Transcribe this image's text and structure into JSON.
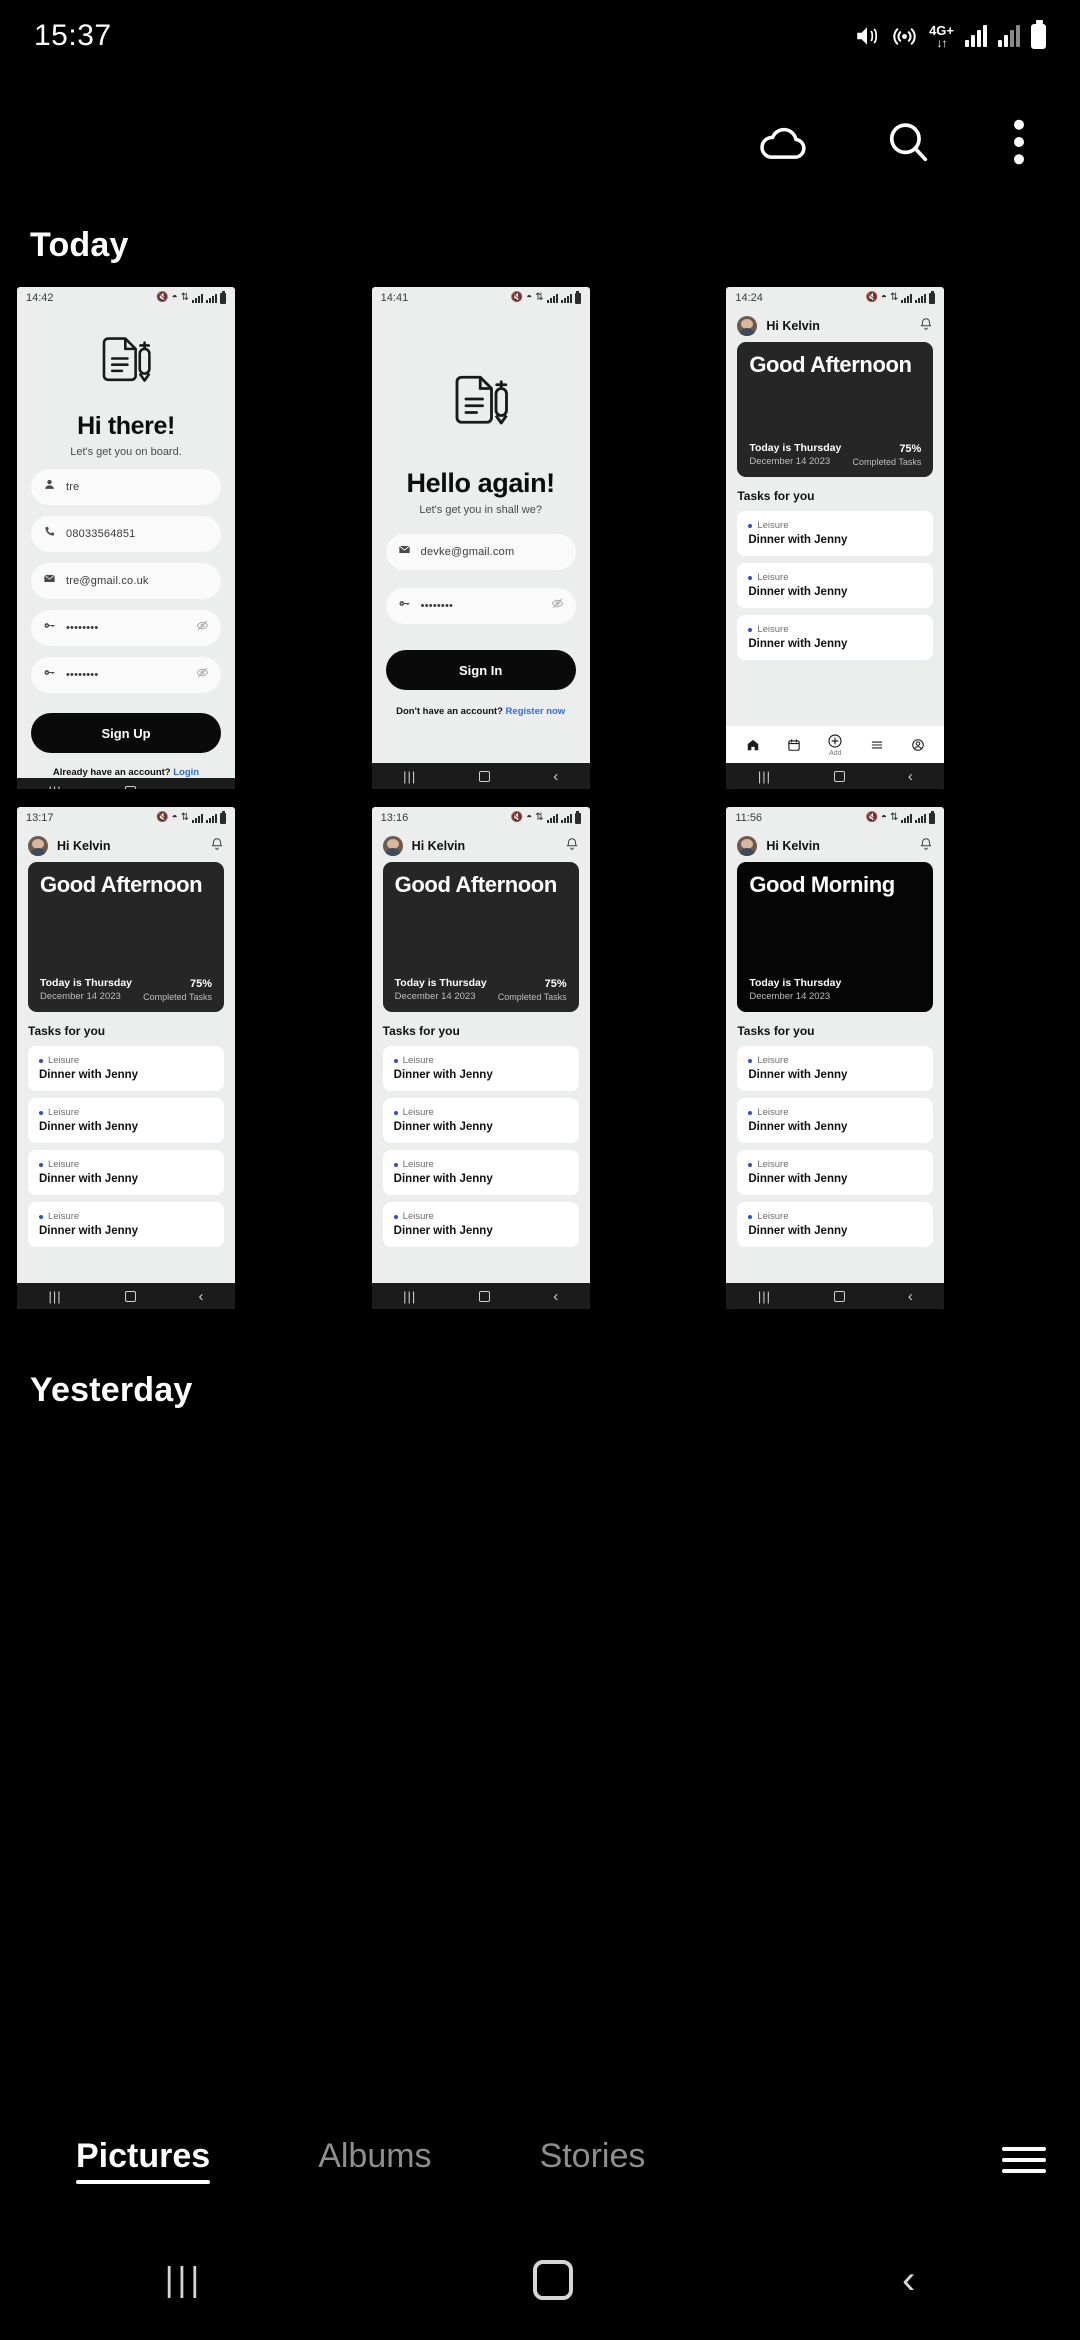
{
  "status_bar": {
    "time": "15:37",
    "icons": [
      "mute-icon",
      "hotspot-icon",
      "network-4g-plus-icon",
      "signal-icon",
      "signal-icon",
      "battery-icon"
    ],
    "network": "4G+"
  },
  "app_bar": {
    "cloud_label": "cloud-icon",
    "search_label": "search-icon",
    "more_label": "more-options-icon"
  },
  "sections": {
    "today": "Today",
    "yesterday": "Yesterday"
  },
  "bottom_tabs": {
    "items": [
      {
        "label": "Pictures",
        "active": true
      },
      {
        "label": "Albums",
        "active": false
      },
      {
        "label": "Stories",
        "active": false
      }
    ],
    "menu_label": "hamburger-menu-icon"
  },
  "nav_bar": {
    "recents": "|||",
    "home": "home-button",
    "back": "‹"
  },
  "shots": [
    {
      "id": "signup",
      "time": "14:42",
      "type": "auth",
      "heading": "Hi there!",
      "subtitle": "Let's get you on board.",
      "fields": [
        {
          "icon": "person-icon",
          "value": "tre",
          "eye": false
        },
        {
          "icon": "phone-icon",
          "value": "08033564851",
          "eye": false
        },
        {
          "icon": "mail-icon",
          "value": "tre@gmail.co.uk",
          "eye": false
        },
        {
          "icon": "key-icon",
          "value": "••••••••",
          "eye": true
        },
        {
          "icon": "key-icon",
          "value": "••••••••",
          "eye": true
        }
      ],
      "cta": "Sign Up",
      "foot_text": "Already have an account? ",
      "foot_link": "Login"
    },
    {
      "id": "signin",
      "time": "14:41",
      "type": "auth",
      "heading": "Hello again!",
      "subtitle": "Let's get you in shall we?",
      "fields": [
        {
          "icon": "mail-icon",
          "value": "devke@gmail.com",
          "eye": false
        },
        {
          "icon": "key-icon",
          "value": "••••••••",
          "eye": true
        }
      ],
      "cta": "Sign In",
      "foot_text": "Don't have an account? ",
      "foot_link": "Register now"
    },
    {
      "id": "home-1424",
      "time": "14:24",
      "type": "task",
      "greeting_user": "Hi Kelvin",
      "banner": {
        "title": "Good Afternoon",
        "day": "Today is Thursday",
        "date": "December 14 2023",
        "percent": "75%",
        "percent_label": "Completed Tasks",
        "dark": false
      },
      "tasks_label": "Tasks for you",
      "tasks": [
        {
          "category": "Leisure",
          "title": "Dinner with Jenny"
        },
        {
          "category": "Leisure",
          "title": "Dinner with Jenny"
        },
        {
          "category": "Leisure",
          "title": "Dinner with Jenny"
        }
      ],
      "tabbar": [
        {
          "icon": "home-icon",
          "label": ""
        },
        {
          "icon": "calendar-icon",
          "label": ""
        },
        {
          "icon": "add-icon",
          "label": "Add"
        },
        {
          "icon": "list-icon",
          "label": ""
        },
        {
          "icon": "profile-icon",
          "label": ""
        }
      ]
    },
    {
      "id": "home-1317",
      "time": "13:17",
      "type": "task",
      "greeting_user": "Hi Kelvin",
      "banner": {
        "title": "Good Afternoon",
        "day": "Today is Thursday",
        "date": "December 14 2023",
        "percent": "75%",
        "percent_label": "Completed Tasks",
        "dark": false
      },
      "tasks_label": "Tasks for you",
      "tasks": [
        {
          "category": "Leisure",
          "title": "Dinner with Jenny"
        },
        {
          "category": "Leisure",
          "title": "Dinner with Jenny"
        },
        {
          "category": "Leisure",
          "title": "Dinner with Jenny"
        },
        {
          "category": "Leisure",
          "title": "Dinner with Jenny"
        }
      ]
    },
    {
      "id": "home-1316",
      "time": "13:16",
      "type": "task",
      "greeting_user": "Hi Kelvin",
      "banner": {
        "title": "Good Afternoon",
        "day": "Today is Thursday",
        "date": "December 14 2023",
        "percent": "75%",
        "percent_label": "Completed Tasks",
        "dark": false
      },
      "tasks_label": "Tasks for you",
      "tasks": [
        {
          "category": "Leisure",
          "title": "Dinner with Jenny"
        },
        {
          "category": "Leisure",
          "title": "Dinner with Jenny"
        },
        {
          "category": "Leisure",
          "title": "Dinner with Jenny"
        },
        {
          "category": "Leisure",
          "title": "Dinner with Jenny"
        }
      ]
    },
    {
      "id": "home-1156",
      "time": "11:56",
      "type": "task",
      "greeting_user": "Hi Kelvin",
      "banner": {
        "title": "Good Morning",
        "day": "Today is Thursday",
        "date": "December 14 2023",
        "percent": "",
        "percent_label": "",
        "dark": true
      },
      "tasks_label": "Tasks for you",
      "tasks": [
        {
          "category": "Leisure",
          "title": "Dinner with Jenny"
        },
        {
          "category": "Leisure",
          "title": "Dinner with Jenny"
        },
        {
          "category": "Leisure",
          "title": "Dinner with Jenny"
        },
        {
          "category": "Leisure",
          "title": "Dinner with Jenny"
        }
      ]
    }
  ],
  "colors": {
    "background": "#000000",
    "card_bg": "#eceded",
    "banner_dark": "#262626",
    "accent_link": "#2f6fdd",
    "task_dot": "#2b4fd6"
  }
}
